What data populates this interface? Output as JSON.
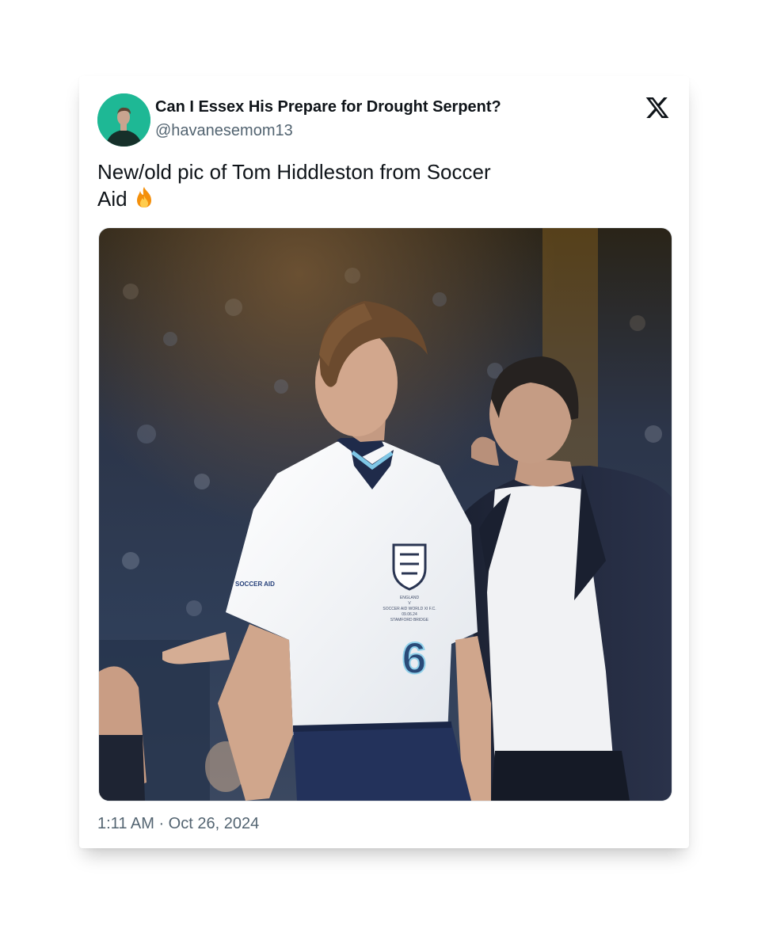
{
  "tweet": {
    "display_name": "Can I Essex His Prepare for Drought Serpent?",
    "handle": "@havanesemom13",
    "text": "New/old pic of Tom Hiddleston from Soccer Aid",
    "emoji_icon": "fire-icon",
    "timestamp": "1:11 AM · Oct 26, 2024",
    "platform_icon": "x-logo-icon"
  },
  "media": {
    "shirt_number": "6",
    "shirt_text": [
      "ENGLAND",
      "V",
      "SOCCER AID WORLD XI F.C.",
      "09.06.24",
      "STAMFORD BRIDGE"
    ],
    "sleeve_text": "SOCCER AID"
  },
  "colors": {
    "text_primary": "#0f1419",
    "text_secondary": "#536471",
    "avatar_bg": "#1eb895"
  }
}
